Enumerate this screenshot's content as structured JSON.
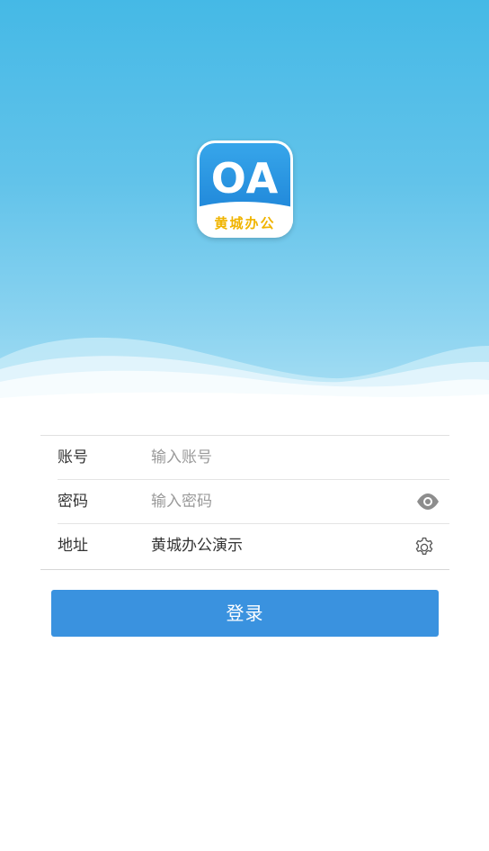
{
  "logo": {
    "title": "OA",
    "subtitle": "黄城办公"
  },
  "form": {
    "account": {
      "label": "账号",
      "placeholder": "输入账号",
      "value": ""
    },
    "password": {
      "label": "密码",
      "placeholder": "输入密码",
      "value": "",
      "toggle_icon": "eye-icon"
    },
    "address": {
      "label": "地址",
      "value": "黄城办公演示",
      "settings_icon": "gear-icon"
    }
  },
  "login_button": {
    "label": "登录"
  },
  "colors": {
    "sky_top": "#45b9e6",
    "sky_bottom": "#a9dff4",
    "button": "#3a92df",
    "logo_blue": "#1f86d9",
    "logo_gold": "#f0b400"
  }
}
